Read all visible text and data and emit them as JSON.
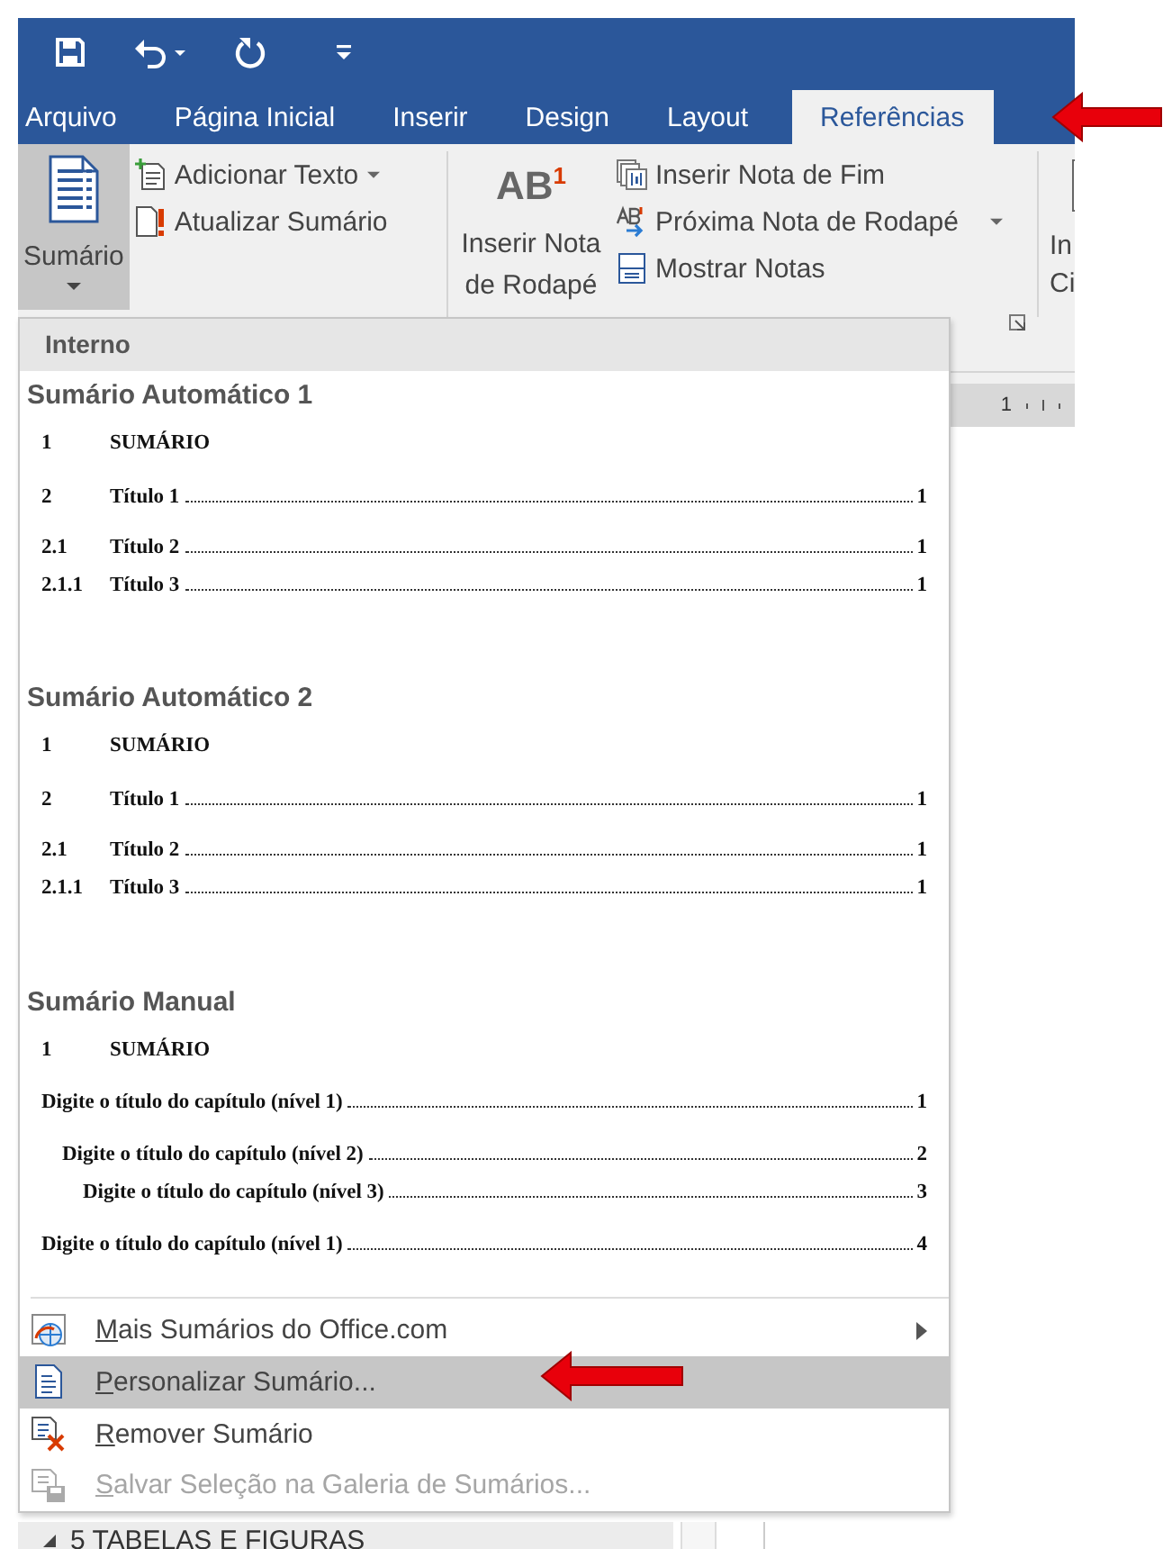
{
  "ribbon": {
    "tabs": [
      {
        "label": "Arquivo",
        "selected": false
      },
      {
        "label": "Página Inicial",
        "selected": false
      },
      {
        "label": "Inserir",
        "selected": false
      },
      {
        "label": "Design",
        "selected": false
      },
      {
        "label": "Layout",
        "selected": false
      },
      {
        "label": "Referências",
        "selected": true
      }
    ],
    "toc_group": {
      "main_button": {
        "label": "Sumário",
        "pressed": true
      },
      "commands": [
        {
          "label": "Adicionar Texto",
          "kind": "add",
          "dropdown": true
        },
        {
          "label": "Atualizar Sumário",
          "kind": "update",
          "dropdown": false
        }
      ]
    },
    "notes_group": {
      "main_button": {
        "label": "Inserir Nota de Rodapé",
        "icon_text": "AB$^{1}$"
      },
      "commands": [
        {
          "label": "Inserir Nota de Fim",
          "kind": "endnote",
          "dropdown": false
        },
        {
          "label": "Próxima Nota de Rodapé",
          "kind": "next",
          "dropdown": true
        },
        {
          "label": "Mostrar Notas",
          "kind": "show",
          "dropdown": false
        }
      ]
    },
    "cut_group": {
      "label_lines": [
        "In",
        "Ci"
      ]
    }
  },
  "ruler": {
    "mark": "1"
  },
  "menu": {
    "header": "Interno",
    "galleries": [
      {
        "title": "Sumário Automático 1",
        "entries": [
          {
            "kind": "heading",
            "number": "1",
            "text": "SUMÁRIO"
          },
          {
            "kind": "entry",
            "number": "2",
            "text": "Título 1",
            "page": "1",
            "children": [
              {
                "kind": "entry",
                "number": "2.1",
                "text": "Título 2",
                "page": "1",
                "children": [
                  {
                    "kind": "entry",
                    "number": "2.1.1",
                    "text": "Título 3",
                    "page": "1"
                  }
                ]
              }
            ]
          }
        ]
      },
      {
        "title": "Sumário Automático 2",
        "entries": [
          {
            "kind": "heading",
            "number": "1",
            "text": "SUMÁRIO"
          },
          {
            "kind": "entry",
            "number": "2",
            "text": "Título 1",
            "page": "1",
            "children": [
              {
                "kind": "entry",
                "number": "2.1",
                "text": "Título 2",
                "page": "1",
                "children": [
                  {
                    "kind": "entry",
                    "number": "2.1.1",
                    "text": "Título 3",
                    "page": "1"
                  }
                ]
              }
            ]
          }
        ]
      },
      {
        "title": "Sumário Manual",
        "entries": [
          {
            "kind": "heading",
            "number": "1",
            "text": "SUMÁRIO"
          },
          {
            "kind": "manual",
            "text": "Digite o título do capítulo (nível 1)",
            "page": "1",
            "children": [
              {
                "kind": "manual",
                "text": "Digite o título do capítulo (nível 2)",
                "page": "2",
                "children": [
                  {
                    "kind": "manual",
                    "text": "Digite o título do capítulo (nível 3)",
                    "page": "3"
                  }
                ]
              }
            ]
          },
          {
            "kind": "manual",
            "text": "Digite o título do capítulo (nível 1)",
            "page": "4"
          }
        ]
      }
    ],
    "items": [
      {
        "label": "Mais Sumários do Office.com",
        "kind": "online",
        "submenu": true,
        "selected": false,
        "disabled": false
      },
      {
        "label": "Personalizar Sumário...",
        "kind": "custom",
        "submenu": false,
        "selected": true,
        "disabled": false
      },
      {
        "label": "Remover Sumário",
        "kind": "remove",
        "submenu": false,
        "selected": false,
        "disabled": false
      },
      {
        "label": "Salvar Seleção na Galeria de Sumários...",
        "kind": "save",
        "submenu": false,
        "selected": false,
        "disabled": true
      }
    ]
  },
  "navigation_pane": {
    "item": "5 TABELAS E FIGURAS"
  }
}
